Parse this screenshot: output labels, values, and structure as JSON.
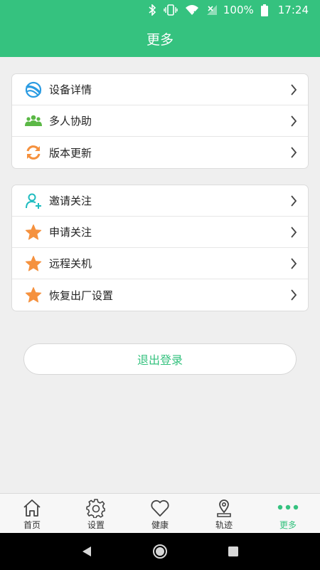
{
  "status": {
    "battery": "100%",
    "time": "17:24"
  },
  "header": {
    "title": "更多"
  },
  "colors": {
    "primary": "#35c27f",
    "orange": "#f5913e",
    "blue": "#2a9be2",
    "teal": "#1fbcc0",
    "green": "#5bb846"
  },
  "section1": {
    "items": [
      {
        "label": "设备详情",
        "icon": "device-ring-icon"
      },
      {
        "label": "多人协助",
        "icon": "group-icon"
      },
      {
        "label": "版本更新",
        "icon": "refresh-icon"
      }
    ]
  },
  "section2": {
    "items": [
      {
        "label": "邀请关注",
        "icon": "add-user-icon"
      },
      {
        "label": "申请关注",
        "icon": "star-icon"
      },
      {
        "label": "远程关机",
        "icon": "star-icon"
      },
      {
        "label": "恢复出厂设置",
        "icon": "star-icon"
      }
    ]
  },
  "logout": {
    "label": "退出登录"
  },
  "tabs": [
    {
      "label": "首页",
      "icon": "home-icon"
    },
    {
      "label": "设置",
      "icon": "gear-icon"
    },
    {
      "label": "健康",
      "icon": "heart-icon"
    },
    {
      "label": "轨迹",
      "icon": "location-pin-icon"
    },
    {
      "label": "更多",
      "icon": "more-dots-icon",
      "active": true
    }
  ]
}
